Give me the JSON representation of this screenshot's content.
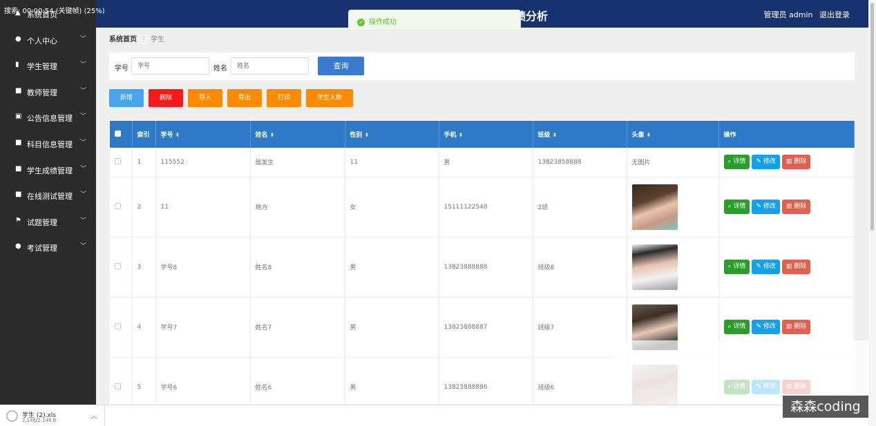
{
  "recording": "搜索: 00:00:54 (关键帧) (25%)",
  "header": {
    "system_name": "绩分析",
    "user_label": "管理员 admin",
    "logout": "退出登录"
  },
  "toast": "操作成功",
  "sidebar": {
    "items": [
      {
        "label": "系统首页",
        "icon": "home-icon"
      },
      {
        "label": "个人中心",
        "icon": "user-icon"
      },
      {
        "label": "学生管理",
        "icon": "chart-icon"
      },
      {
        "label": "教师管理",
        "icon": "grid-icon"
      },
      {
        "label": "公告信息管理",
        "icon": "image-icon"
      },
      {
        "label": "科目信息管理",
        "icon": "grid-icon"
      },
      {
        "label": "学生成绩管理",
        "icon": "grid-icon"
      },
      {
        "label": "在线测试管理",
        "icon": "grid-icon"
      },
      {
        "label": "试题管理",
        "icon": "flag-icon"
      },
      {
        "label": "考试管理",
        "icon": "pin-icon"
      }
    ]
  },
  "breadcrumb": {
    "home": "系统首页",
    "current": "学生"
  },
  "search": {
    "xh_label": "学号",
    "xh_placeholder": "学号",
    "xm_label": "姓名",
    "xm_placeholder": "姓名",
    "query": "查询"
  },
  "actions": {
    "add": "新增",
    "delete": "删除",
    "import": "导入",
    "export": "导出",
    "print": "打印",
    "count": "学生人数"
  },
  "table": {
    "headers": {
      "index": "索引",
      "xuehao": "学号",
      "xingming": "姓名",
      "xingbie": "性别",
      "shouji": "手机",
      "banji": "班级",
      "touxiang": "头像",
      "caozuo": "操作"
    },
    "rows": [
      {
        "index": "1",
        "xuehao": "115552",
        "xingming": "是发生",
        "xingbie": "11",
        "shouji": "男",
        "banji": "13823858888",
        "touxiang": "无图片"
      },
      {
        "index": "2",
        "xuehao": "11",
        "xingming": "地方",
        "xingbie": "女",
        "shouji": "15111122548",
        "banji": "2班",
        "touxiang": ""
      },
      {
        "index": "3",
        "xuehao": "学号8",
        "xingming": "姓名8",
        "xingbie": "男",
        "shouji": "13823888888",
        "banji": "班级8",
        "touxiang": ""
      },
      {
        "index": "4",
        "xuehao": "学号7",
        "xingming": "姓名7",
        "xingbie": "男",
        "shouji": "13823888887",
        "banji": "班级7",
        "touxiang": ""
      },
      {
        "index": "5",
        "xuehao": "学号6",
        "xingming": "姓名6",
        "xingbie": "男",
        "shouji": "13823888886",
        "banji": "班级6",
        "touxiang": ""
      }
    ],
    "ops": {
      "detail": "详情",
      "edit": "修改",
      "delete": "删除"
    }
  },
  "download": {
    "name": "学生 (2).xls",
    "size": "2,146/2,146 B"
  },
  "watermark": "森森coding",
  "colors": {
    "header": "#17326e",
    "sidebar": "#2b2b2b",
    "add": "#4aa3ee",
    "delete": "#f51a1a",
    "orange": "#ff8c00",
    "query": "#3a7bd0"
  }
}
